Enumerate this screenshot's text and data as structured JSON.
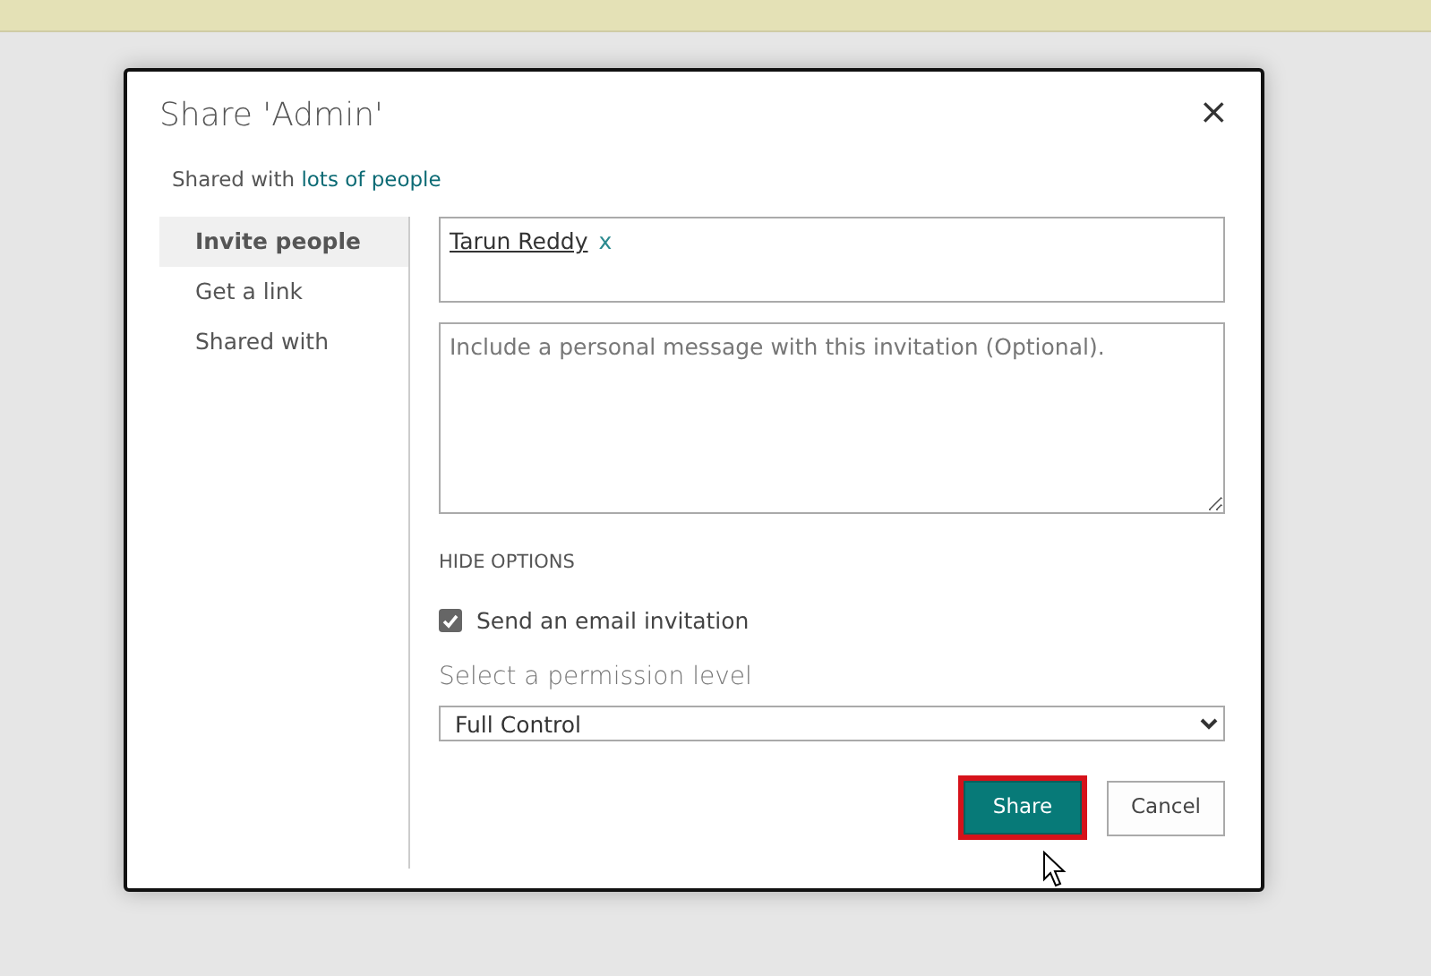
{
  "dialog": {
    "title": "Share 'Admin'",
    "close": "×",
    "shared_with": {
      "prefix": "Shared with",
      "link": "lots of people"
    }
  },
  "sidebar": {
    "items": [
      {
        "label": "Invite people",
        "selected": true
      },
      {
        "label": "Get a link",
        "selected": false
      },
      {
        "label": "Shared with",
        "selected": false
      }
    ]
  },
  "invitees": [
    {
      "name": "Tarun Reddy",
      "remove": "x"
    }
  ],
  "message": {
    "placeholder": "Include a personal message with this invitation (Optional)."
  },
  "options_toggle": "HIDE OPTIONS",
  "send_email": {
    "label": "Send an email invitation",
    "checked": true
  },
  "permission": {
    "label": "Select a permission level",
    "value": "Full Control"
  },
  "buttons": [
    {
      "label": "Share",
      "kind": "primary",
      "highlighted": true
    },
    {
      "label": "Cancel",
      "kind": "secondary",
      "highlighted": false
    }
  ]
}
